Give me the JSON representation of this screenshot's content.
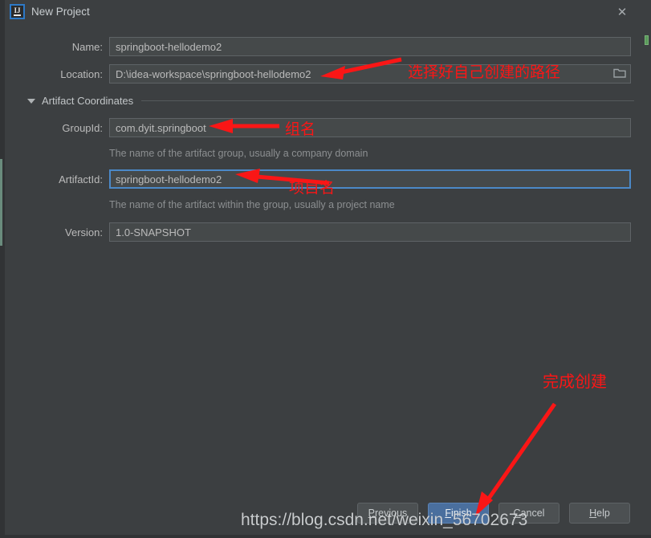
{
  "window": {
    "title": "New Project",
    "logo_text": "IJ",
    "close_label": "✕"
  },
  "form": {
    "name": {
      "label": "Name:",
      "value": "springboot-hellodemo2",
      "placeholder": ""
    },
    "location": {
      "label": "Location:",
      "value": "D:\\idea-workspace\\springboot-hellodemo2",
      "placeholder": "",
      "browse_icon": "folder-icon"
    },
    "section": {
      "title": "Artifact Coordinates",
      "collapse_icon": "chevron-down-icon"
    },
    "group_id": {
      "label": "GroupId:",
      "value": "com.dyit.springboot",
      "hint": "The name of the artifact group, usually a company domain"
    },
    "artifact_id": {
      "label": "ArtifactId:",
      "value": "springboot-hellodemo2",
      "hint": "The name of the artifact within the group, usually a project name"
    },
    "version": {
      "label": "Version:",
      "value": "1.0-SNAPSHOT"
    }
  },
  "buttons": {
    "previous": {
      "mnemonic": "P",
      "rest": "revious"
    },
    "finish": {
      "mnemonic": "F",
      "rest": "inish"
    },
    "cancel": {
      "mnemonic": "C",
      "rest": "ancel"
    },
    "help": {
      "mnemonic": "H",
      "rest": "elp"
    }
  },
  "annotations": {
    "path_note": "选择好自己创建的路径",
    "group_note": "组名",
    "project_note": "项目名",
    "finish_note": "完成创建"
  },
  "watermark": {
    "text": "https://blog.csdn.net/weixin_56702673"
  },
  "colors": {
    "dialog_bg": "#3c3f41",
    "input_bg": "#45494a",
    "focus_border": "#4b89c8",
    "primary_button": "#4a6f9e",
    "annotation_red": "#fa1616",
    "label_text": "#bbbbbb",
    "hint_text": "#8c8f91",
    "left_marker": "#6a8c7d",
    "right_marker": "#5a9a5a"
  }
}
